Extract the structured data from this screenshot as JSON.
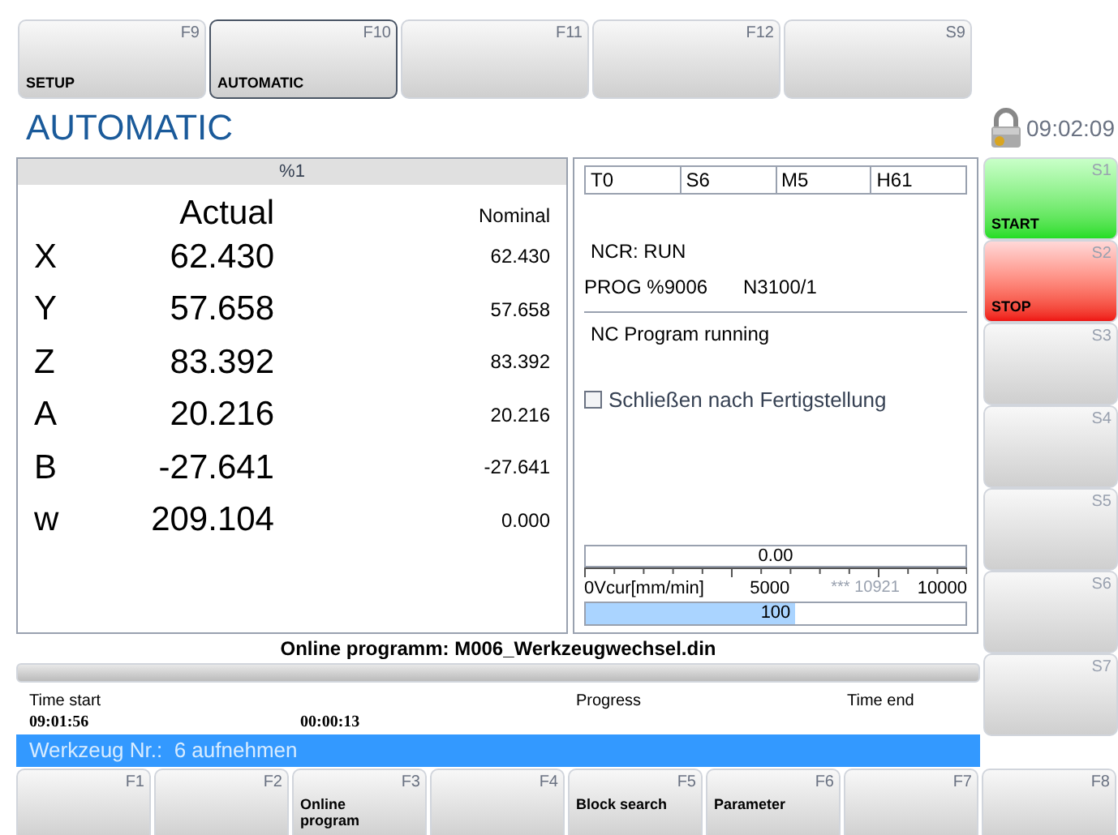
{
  "top_keys": [
    {
      "key": "F9",
      "label": "SETUP",
      "selected": false
    },
    {
      "key": "F10",
      "label": "AUTOMATIC",
      "selected": true
    },
    {
      "key": "F11",
      "selected": false
    },
    {
      "key": "F12",
      "selected": false
    },
    {
      "key": "S9",
      "selected": false
    }
  ],
  "title": "AUTOMATIC",
  "locked": true,
  "clock": "09:02:09",
  "axes_panel": {
    "header": "%1",
    "actual_heading": "Actual",
    "nominal_heading": "Nominal",
    "rows": [
      {
        "axis": "X",
        "actual": "62.430",
        "nominal": "62.430"
      },
      {
        "axis": "Y",
        "actual": "57.658",
        "nominal": "57.658"
      },
      {
        "axis": "Z",
        "actual": "83.392",
        "nominal": "83.392"
      },
      {
        "axis": "A",
        "actual": "20.216",
        "nominal": "20.216"
      },
      {
        "axis": "B",
        "actual": "-27.641",
        "nominal": "-27.641"
      },
      {
        "axis": "w",
        "actual": "209.104",
        "nominal": "0.000"
      }
    ]
  },
  "status_panel": {
    "codes": [
      "T0",
      "S6",
      "M5",
      "H61"
    ],
    "ncr": "NCR: RUN",
    "prog": "PROG %9006",
    "block": "N3100/1",
    "message": "NC Program running",
    "checkbox": {
      "label": "Schließen nach Fertigstellung",
      "checked": false
    },
    "feed_gauge": {
      "value": "0.00",
      "scale_start": "0",
      "unit": "Vcur[mm/min]",
      "scale_mid": "5000",
      "reading": "*** 10921",
      "scale_end": "10000"
    },
    "override": {
      "value": "100",
      "level": 0.55
    }
  },
  "side_keys": [
    {
      "key": "S1",
      "label": "START",
      "kind": "start"
    },
    {
      "key": "S2",
      "label": "STOP",
      "kind": "stop"
    },
    {
      "key": "S3",
      "kind": "plain"
    },
    {
      "key": "S4",
      "kind": "plain"
    },
    {
      "key": "S5",
      "kind": "plain"
    },
    {
      "key": "S6",
      "kind": "plain"
    },
    {
      "key": "S7",
      "kind": "plain"
    }
  ],
  "program": {
    "title": "Online programm: M006_Werkzeugwechsel.din",
    "level": 0,
    "time_start_label": "Time start",
    "progress_label": "Progress",
    "time_end_label": "Time end",
    "time_start": "09:01:56",
    "elapsed": "00:00:13"
  },
  "message_bar": "Werkzeug Nr.:  6 aufnehmen",
  "bottom_keys": [
    {
      "key": "F1"
    },
    {
      "key": "F2"
    },
    {
      "key": "F3",
      "label": "Online program"
    },
    {
      "key": "F4"
    },
    {
      "key": "F5",
      "label": "Block search"
    },
    {
      "key": "F6",
      "label": "Parameter"
    },
    {
      "key": "F7"
    },
    {
      "key": "F8"
    }
  ]
}
